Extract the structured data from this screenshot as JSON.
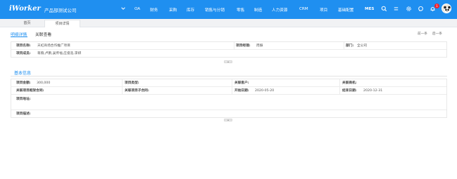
{
  "header": {
    "logo": "iWorker",
    "company": "产品部测试公司",
    "nav": [
      "OA",
      "财务",
      "采购",
      "库存",
      "销售与分销",
      "零售",
      "制造",
      "人力资源",
      "CRM",
      "项目",
      "基础配置",
      "MES"
    ],
    "notification_count": "1",
    "icons": [
      "chevron-down-icon",
      "search-icon",
      "menu-icon",
      "gear-icon",
      "message-icon",
      "bell-icon"
    ]
  },
  "page_tabs": {
    "home": "首页",
    "project_detail": "项目详情"
  },
  "sub_tabs": {
    "detail": "明细详情",
    "related": "关联查看"
  },
  "pager": {
    "prev": "前一条",
    "next": "后一条"
  },
  "summary": {
    "name_label": "项目名称:",
    "name_value": "天虹商场合作推广项目",
    "manager_label": "项目经理:",
    "manager_value": "周振",
    "dept_label": "部门:",
    "dept_value": "全公司",
    "members_label": "项目成员:",
    "members_value": "蒋薇,卢鹏,吴传福,庄俊浩,李妍"
  },
  "basic": {
    "title": "基本信息",
    "amount_label": "项目金额:",
    "amount_value": "300,000",
    "type_label": "项目类型:",
    "type_value": "",
    "customer_label": "关联客户:",
    "customer_value": "",
    "opportunity_label": "关联商机:",
    "opportunity_value": "",
    "frame_contract_label": "关联项目框架合同:",
    "frame_contract_value": "",
    "sub_contract_label": "关联项目子合同:",
    "sub_contract_value": "",
    "start_label": "开始日期:",
    "start_value": "2020-05-20",
    "end_label": "结束日期:",
    "end_value": "2020-12-31",
    "address_label": "项目地址:",
    "address_value": "",
    "desc_label": "项目描述:",
    "desc_value": ""
  },
  "colors": {
    "primary": "#1f8ff0",
    "badge": "#f5222d"
  }
}
